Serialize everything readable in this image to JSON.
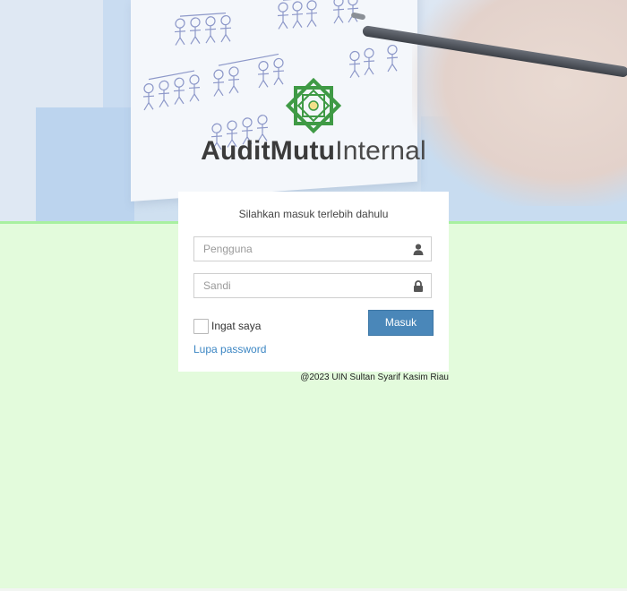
{
  "brand": {
    "name_bold": "AuditMutu",
    "name_light": "Internal",
    "emblem_color": "#3f9a45"
  },
  "login": {
    "subtitle": "Silahkan masuk terlebih dahulu",
    "username": {
      "placeholder": "Pengguna",
      "value": "",
      "icon": "user-icon"
    },
    "password": {
      "placeholder": "Sandi",
      "value": "",
      "icon": "lock-icon"
    },
    "remember_label": "Ingat saya",
    "remember_checked": false,
    "submit_label": "Masuk",
    "forgot_label": "Lupa password"
  },
  "footer": {
    "copyright": "@2023 UIN Sultan Syarif Kasim Riau"
  },
  "colors": {
    "page_background": "#e3fbdc",
    "button": "#4a87b9",
    "link": "#3c86c3",
    "hero_divider": "#a8f0a0"
  }
}
